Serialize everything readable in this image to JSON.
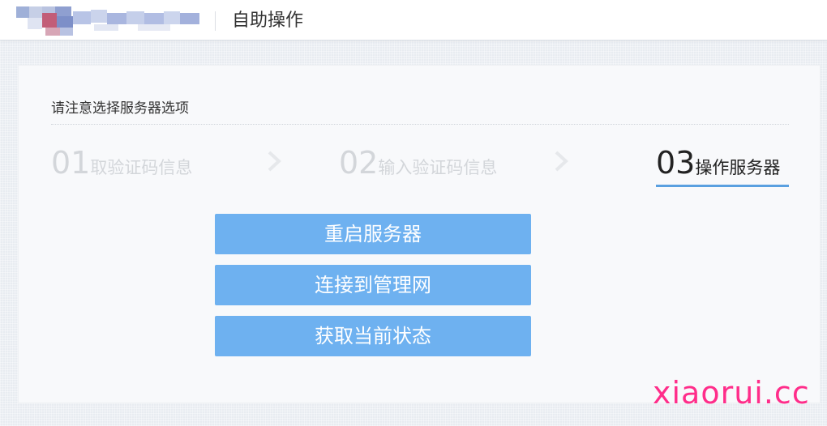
{
  "header": {
    "title": "自助操作"
  },
  "main": {
    "notice": "请注意选择服务器选项",
    "steps": [
      {
        "num": "01",
        "label": "取验证码信息",
        "state": "inactive"
      },
      {
        "num": "02",
        "label": "输入验证码信息",
        "state": "inactive"
      },
      {
        "num": "03",
        "label": "操作服务器",
        "state": "active"
      }
    ],
    "actions": {
      "reboot": "重启服务器",
      "connect_mgmt": "连接到管理网",
      "get_status": "获取当前状态"
    }
  },
  "watermark": "xiaorui.cc",
  "colors": {
    "accent": "#6eb1f0",
    "step_underline": "#5aa0e0",
    "inactive_step": "#d3d6da",
    "watermark": "#ff2d8a"
  }
}
